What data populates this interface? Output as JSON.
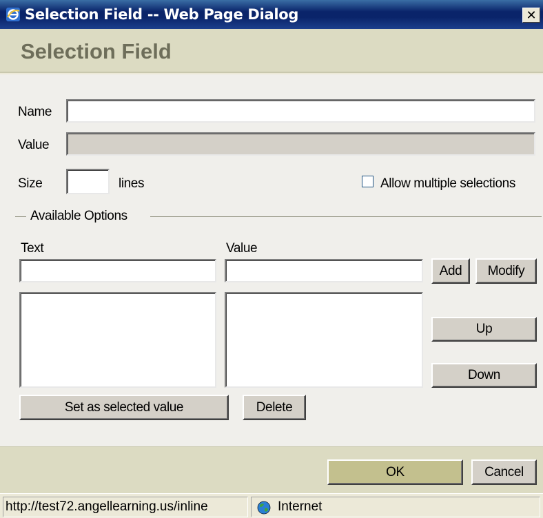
{
  "window": {
    "title": "Selection Field -- Web Page Dialog",
    "close_glyph": "✕"
  },
  "header": {
    "title": "Selection Field"
  },
  "form": {
    "name_label": "Name",
    "name_value": "",
    "value_label": "Value",
    "value_value": "",
    "size_label": "Size",
    "size_value": "",
    "size_unit": "lines",
    "allow_multiple_label": "Allow multiple selections",
    "allow_multiple_checked": false
  },
  "options": {
    "legend": "Available Options",
    "text_header": "Text",
    "value_header": "Value",
    "text_input": "",
    "value_input": "",
    "add_label": "Add",
    "modify_label": "Modify",
    "up_label": "Up",
    "down_label": "Down",
    "set_selected_label": "Set as selected value",
    "delete_label": "Delete",
    "text_list": [],
    "value_list": []
  },
  "footer": {
    "ok_label": "OK",
    "cancel_label": "Cancel"
  },
  "statusbar": {
    "url": "http://test72.angellearning.us/inline",
    "zone": "Internet"
  },
  "icons": {
    "app": "ie-icon",
    "zone": "globe-icon"
  },
  "colors": {
    "titlebar": "#0A246A",
    "header_band": "#DCDBC2",
    "page_title": "#6E6E5A",
    "ok_button": "#C3C08E"
  }
}
